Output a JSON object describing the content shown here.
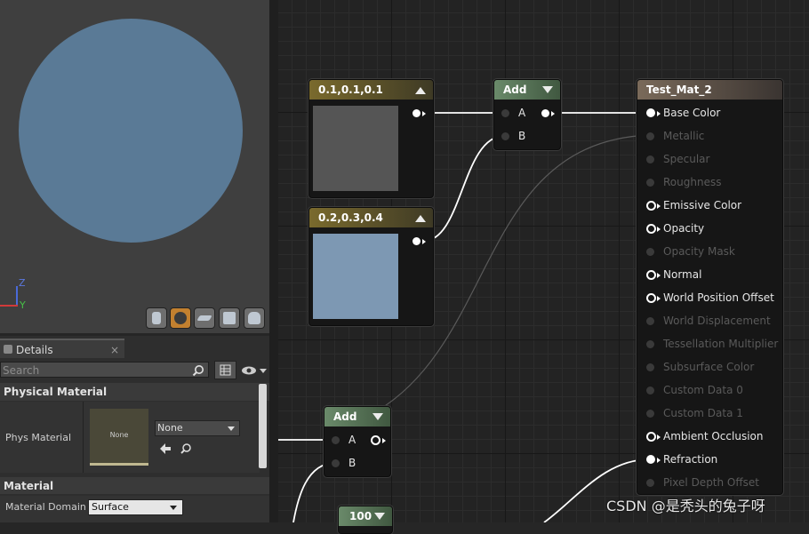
{
  "viewport": {
    "axis_z": "Z",
    "axis_y": "Y",
    "buttons": [
      "cylinder-icon",
      "sphere-icon",
      "plane-icon",
      "cube-icon",
      "custom-mesh-icon"
    ]
  },
  "details": {
    "tab_label": "Details",
    "tab_close": "×",
    "search_placeholder": "Search",
    "categories": {
      "physical_material": "Physical Material",
      "material": "Material"
    },
    "phys_material_label": "Phys Material",
    "phys_material_thumb": "None",
    "phys_material_value": "None",
    "material_domain_label": "Material Domain",
    "material_domain_value": "Surface"
  },
  "graph": {
    "const1": {
      "title": "0.1,0.1,0.1",
      "color": "#555555"
    },
    "const2": {
      "title": "0.2,0.3,0.4",
      "color": "#7d98b3"
    },
    "add1": {
      "title": "Add",
      "pins": [
        "A",
        "B"
      ]
    },
    "add2": {
      "title": "Add",
      "pins": [
        "A",
        "B"
      ]
    },
    "const_100": {
      "title": "100"
    },
    "material_node": {
      "title": "Test_Mat_2",
      "inputs": [
        {
          "label": "Base Color",
          "active": true
        },
        {
          "label": "Metallic",
          "active": false
        },
        {
          "label": "Specular",
          "active": false
        },
        {
          "label": "Roughness",
          "active": false
        },
        {
          "label": "Emissive Color",
          "active": true
        },
        {
          "label": "Opacity",
          "active": true
        },
        {
          "label": "Opacity Mask",
          "active": false
        },
        {
          "label": "Normal",
          "active": true
        },
        {
          "label": "World Position Offset",
          "active": true
        },
        {
          "label": "World Displacement",
          "active": false
        },
        {
          "label": "Tessellation Multiplier",
          "active": false
        },
        {
          "label": "Subsurface Color",
          "active": false
        },
        {
          "label": "Custom Data 0",
          "active": false
        },
        {
          "label": "Custom Data 1",
          "active": false
        },
        {
          "label": "Ambient Occlusion",
          "active": true
        },
        {
          "label": "Refraction",
          "active": true
        },
        {
          "label": "Pixel Depth Offset",
          "active": false
        }
      ]
    }
  },
  "watermark": "CSDN @是秃头的兔子呀",
  "colors": {
    "sphere": "#5a7a96",
    "selected_view_button": "#c2802f"
  }
}
